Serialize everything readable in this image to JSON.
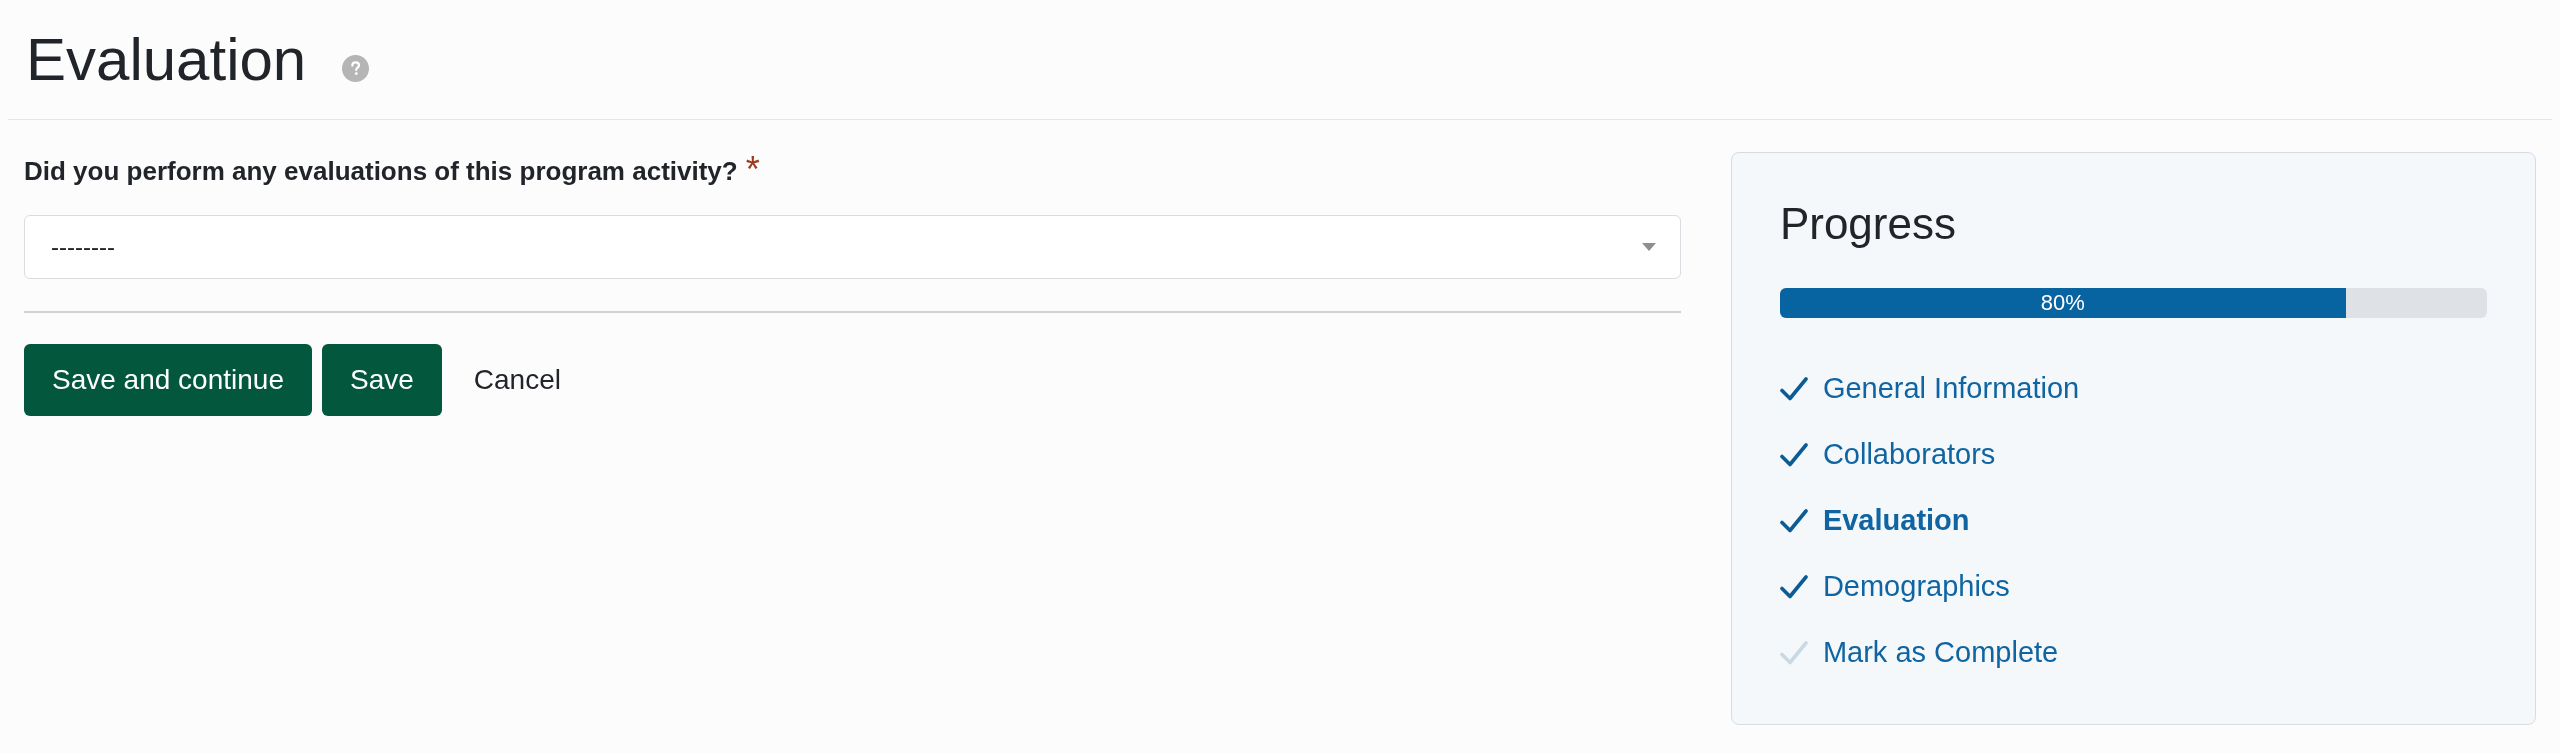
{
  "page": {
    "title": "Evaluation"
  },
  "form": {
    "question": {
      "label": "Did you perform any evaluations of this program activity?",
      "required_mark": "*"
    },
    "select": {
      "value": "--------"
    }
  },
  "buttons": [
    {
      "label": "Save and continue",
      "kind": "primary"
    },
    {
      "label": "Save",
      "kind": "primary"
    },
    {
      "label": "Cancel",
      "kind": "link"
    }
  ],
  "progress": {
    "title": "Progress",
    "level": 0.8,
    "reading": "80%",
    "steps": [
      {
        "label": "General Information",
        "checked": true,
        "selected": false
      },
      {
        "label": "Collaborators",
        "checked": true,
        "selected": false
      },
      {
        "label": "Evaluation",
        "checked": true,
        "selected": true
      },
      {
        "label": "Demographics",
        "checked": true,
        "selected": false
      },
      {
        "label": "Mark as Complete",
        "checked": false,
        "selected": false
      }
    ]
  }
}
